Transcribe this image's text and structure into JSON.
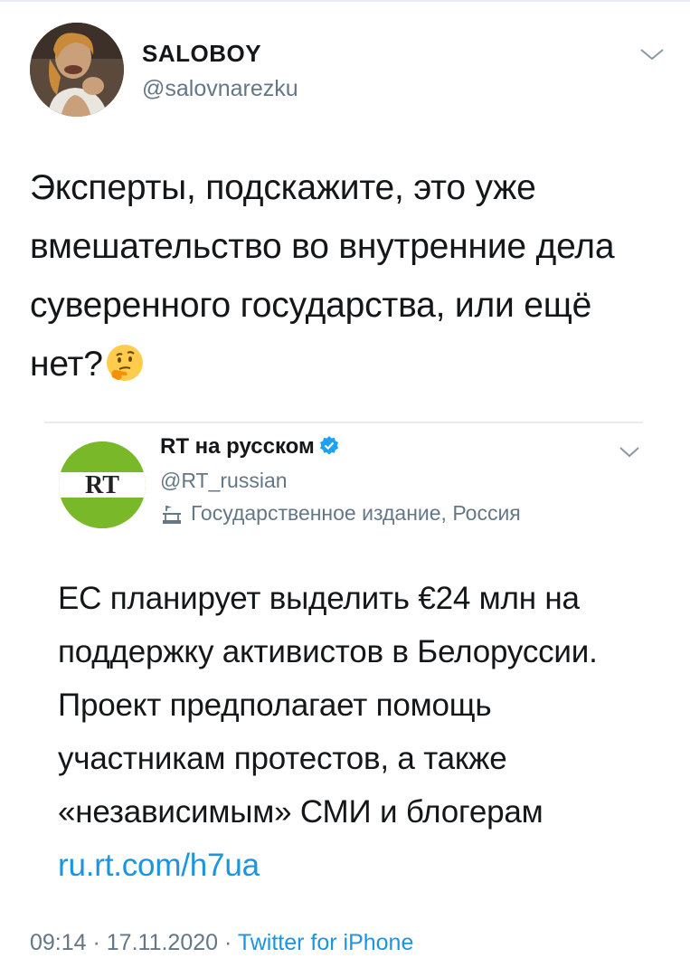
{
  "tweet": {
    "author_name": "SALOBOY",
    "author_handle": "@salovnarezku",
    "text": "Эксперты, подскажите, это уже вмешательство во внутренние дела суверенного государства, или ещё нет?",
    "emoji": "thinking-face-emoji"
  },
  "quoted": {
    "author_name": "RT на русском",
    "author_handle": "@RT_russian",
    "label": "Государственное издание, Россия",
    "logo_text": "RT",
    "text": "ЕС планирует выделить €24 млн на поддержку активистов в Белоруссии. Проект предполагает помощь участникам протестов, а также «независимым» СМИ и блогерам ",
    "link": "ru.rt.com/h7ua"
  },
  "meta": {
    "time": "09:14",
    "sep1": " · ",
    "date": "17.11.2020",
    "sep2": " · ",
    "source": "Twitter for iPhone"
  },
  "colors": {
    "link": "#1b95e0",
    "secondary_text": "#657786",
    "rt_green": "#79b829",
    "verified": "#1da1f2"
  }
}
